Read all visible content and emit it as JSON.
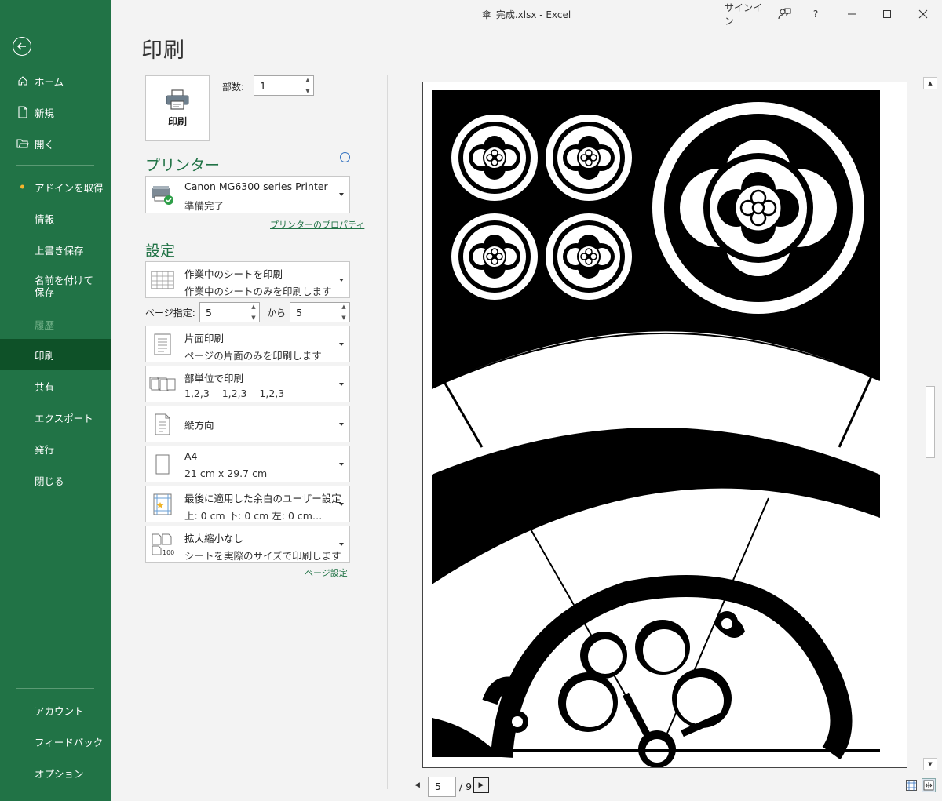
{
  "window": {
    "title": "傘_完成.xlsx  -  Excel",
    "signin": "サインイン",
    "help": "?"
  },
  "sidebar": {
    "items": [
      {
        "label": "ホーム",
        "icon": "home-icon"
      },
      {
        "label": "新規",
        "icon": "new-document-icon"
      },
      {
        "label": "開く",
        "icon": "open-folder-icon"
      },
      {
        "label": "アドインを取得"
      },
      {
        "label": "情報"
      },
      {
        "label": "上書き保存"
      },
      {
        "label": "名前を付けて保存"
      },
      {
        "label": "履歴"
      },
      {
        "label": "印刷"
      },
      {
        "label": "共有"
      },
      {
        "label": "エクスポート"
      },
      {
        "label": "発行"
      },
      {
        "label": "閉じる"
      },
      {
        "label": "アカウント"
      },
      {
        "label": "フィードバック"
      },
      {
        "label": "オプション"
      }
    ],
    "active": "印刷",
    "accent": "#217346",
    "active_bg": "#0e5128"
  },
  "print": {
    "heading": "印刷",
    "button_label": "印刷",
    "copies_label": "部数:",
    "copies_value": "1"
  },
  "printer": {
    "section_title": "プリンター",
    "name": "Canon MG6300 series Printer",
    "status": "準備完了",
    "properties_link": "プリンターのプロパティ",
    "info_icon": "info-icon"
  },
  "settings": {
    "section_title": "設定",
    "what": {
      "title": "作業中のシートを印刷",
      "desc": "作業中のシートのみを印刷します"
    },
    "pages_label": "ページ指定:",
    "pages_from": "5",
    "pages_to_label": "から",
    "pages_to": "5",
    "sides": {
      "title": "片面印刷",
      "desc": "ページの片面のみを印刷します"
    },
    "collate": {
      "title": "部単位で印刷",
      "desc": "1,2,3    1,2,3    1,2,3"
    },
    "orientation": {
      "title": "縦方向"
    },
    "paper": {
      "title": "A4",
      "desc": "21 cm x 29.7 cm"
    },
    "margins": {
      "title": "最後に適用した余白のユーザー設定",
      "desc": "上: 0 cm 下: 0 cm 左: 0 cm…"
    },
    "scaling": {
      "title": "拡大縮小なし",
      "desc": "シートを実際のサイズで印刷します"
    },
    "page_setup_link": "ページ設定"
  },
  "preview": {
    "current_page": "5",
    "total_pages": "/ 9"
  }
}
